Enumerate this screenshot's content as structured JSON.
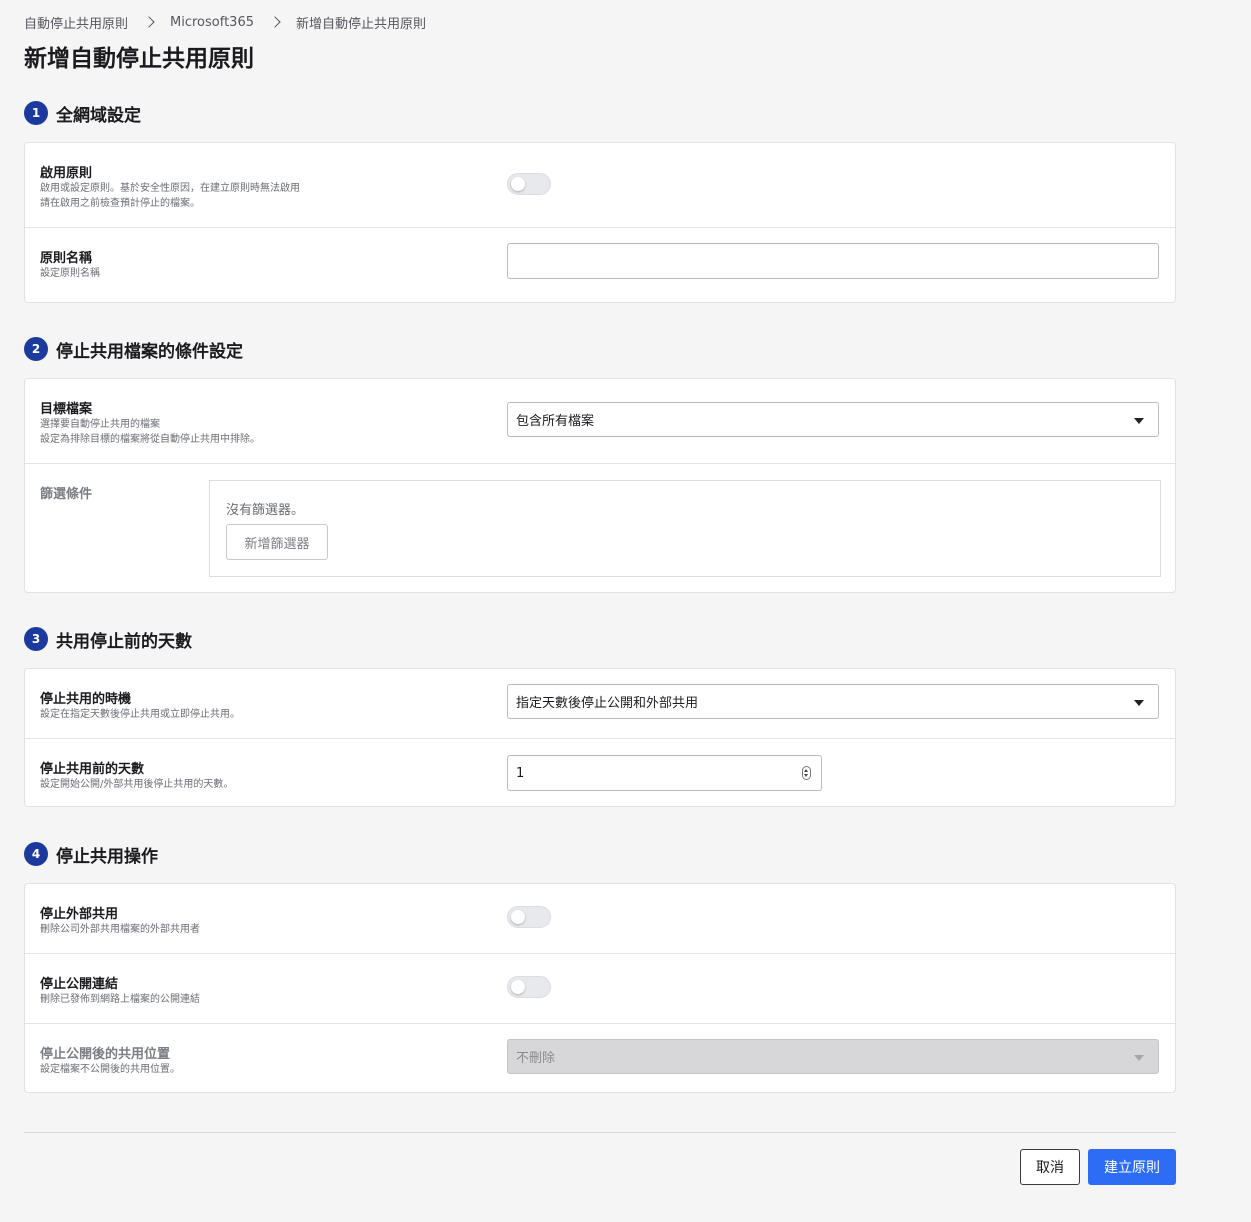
{
  "breadcrumb": [
    "自動停止共用原則",
    "Microsoft365",
    "新增自動停止共用原則"
  ],
  "page_title": "新增自動停止共用原則",
  "sections": [
    {
      "number": "1",
      "title": "全網域設定",
      "rows": [
        {
          "label": "啟用原則",
          "desc1": "啟用或設定原則。基於安全性原因，在建立原則時無法啟用",
          "desc2": "請在啟用之前檢查預計停止的檔案。",
          "toggle_on": false
        },
        {
          "label": "原則名稱",
          "desc": "設定原則名稱",
          "value": ""
        }
      ]
    },
    {
      "number": "2",
      "title": "停止共用檔案的條件設定",
      "rows": [
        {
          "label": "目標檔案",
          "desc1": "選擇要自動停止共用的檔案",
          "desc2": "設定為排除目標的檔案將從自動停止共用中排除。",
          "selected": "包含所有檔案"
        },
        {
          "label": "篩選條件",
          "empty_text": "沒有篩選器。",
          "add_button": "新增篩選器"
        }
      ]
    },
    {
      "number": "3",
      "title": "共用停止前的天數",
      "rows": [
        {
          "label": "停止共用的時機",
          "desc": "設定在指定天數後停止共用或立即停止共用。",
          "selected": "指定天數後停止公開和外部共用"
        },
        {
          "label": "停止共用前的天數",
          "desc": "設定開始公開/外部共用後停止共用的天數。",
          "value": "1"
        }
      ]
    },
    {
      "number": "4",
      "title": "停止共用操作",
      "rows": [
        {
          "label": "停止外部共用",
          "desc": "刪除公司外部共用檔案的外部共用者",
          "toggle_on": false
        },
        {
          "label": "停止公開連結",
          "desc": "刪除已發佈到網路上檔案的公開連結",
          "toggle_on": false
        },
        {
          "label": "停止公開後的共用位置",
          "desc": "設定檔案不公開後的共用位置。",
          "selected": "不刪除",
          "disabled": true
        }
      ]
    }
  ],
  "footer": {
    "cancel_label": "取消",
    "create_label": "建立原則"
  }
}
